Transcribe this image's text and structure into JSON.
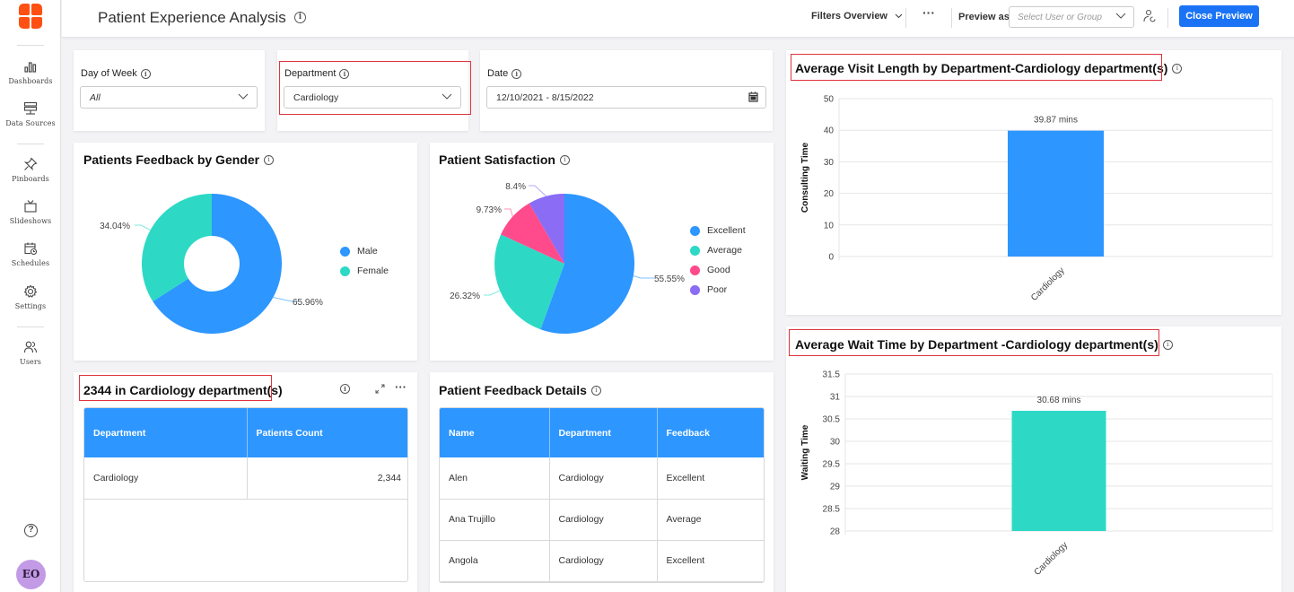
{
  "app": {
    "title": "Patient Experience Analysis",
    "logo": "logo-icon"
  },
  "sidebar": {
    "items": [
      {
        "label": "Dashboards",
        "icon": "bar-chart-icon"
      },
      {
        "label": "Data Sources",
        "icon": "data-sources-icon"
      },
      {
        "label": "Pinboards",
        "icon": "pin-icon"
      },
      {
        "label": "Slideshows",
        "icon": "tv-icon"
      },
      {
        "label": "Schedules",
        "icon": "calendar-clock-icon"
      },
      {
        "label": "Settings",
        "icon": "gear-icon"
      },
      {
        "label": "Users",
        "icon": "users-icon"
      }
    ],
    "help_icon": "help-icon",
    "avatar_initials": "EO"
  },
  "header": {
    "filters_overview": "Filters Overview",
    "more": "···",
    "preview_as_label": "Preview as",
    "user_select_placeholder": "Select User or Group",
    "close_preview": "Close Preview"
  },
  "filters": {
    "day_of_week": {
      "label": "Day of Week",
      "value": "All"
    },
    "department": {
      "label": "Department",
      "value": "Cardiology"
    },
    "date": {
      "label": "Date",
      "value": "12/10/2021 - 8/15/2022"
    }
  },
  "widgets": {
    "gender": {
      "title": "Patients Feedback by Gender"
    },
    "satisfaction": {
      "title": "Patient Satisfaction"
    },
    "count": {
      "title": "2344 in Cardiology department(s)",
      "columns": [
        "Department",
        "Patients Count"
      ],
      "rows": [
        [
          "Cardiology",
          "2,344"
        ]
      ]
    },
    "details": {
      "title": "Patient Feedback Details",
      "columns": [
        "Name",
        "Department",
        "Feedback"
      ],
      "rows": [
        [
          "Alen",
          "Cardiology",
          "Excellent"
        ],
        [
          "Ana Trujillo",
          "Cardiology",
          "Average"
        ],
        [
          "Angola",
          "Cardiology",
          "Excellent"
        ]
      ]
    },
    "visit": {
      "title": "Average Visit Length by Department-Cardiology department(s)"
    },
    "wait": {
      "title": "Average Wait Time by Department -Cardiology department(s)"
    }
  },
  "colors": {
    "blue": "#2d96ff",
    "teal": "#2dd9c5",
    "pink": "#ff4b8b",
    "purple": "#8a6cf5",
    "accent": "#1a73f5",
    "highlight": "#e0333d",
    "excellent": "#3ad06b"
  },
  "chart_data": [
    {
      "type": "pie",
      "title": "Patients Feedback by Gender",
      "donut": true,
      "categories": [
        "Male",
        "Female"
      ],
      "values": [
        65.96,
        34.04
      ],
      "labels": [
        "65.96%",
        "34.04%"
      ],
      "colors": [
        "#2d96ff",
        "#2dd9c5"
      ],
      "legend": "right"
    },
    {
      "type": "pie",
      "title": "Patient Satisfaction",
      "donut": false,
      "categories": [
        "Excellent",
        "Average",
        "Good",
        "Poor"
      ],
      "values": [
        55.55,
        26.32,
        9.73,
        8.4
      ],
      "labels": [
        "55.55%",
        "26.32%",
        "9.73%",
        "8.4%"
      ],
      "colors": [
        "#2d96ff",
        "#2dd9c5",
        "#ff4b8b",
        "#8a6cf5"
      ],
      "legend": "right"
    },
    {
      "type": "bar",
      "title": "Average Visit Length by Department-Cardiology department(s)",
      "categories": [
        "Cardiology"
      ],
      "values": [
        39.87
      ],
      "data_labels": [
        "39.87 mins"
      ],
      "xlabel": "",
      "ylabel": "Consulting Time",
      "ylim": [
        0,
        50
      ],
      "yticks": [
        "0",
        "10",
        "20",
        "30",
        "40",
        "50"
      ],
      "ytick_values": [
        0,
        10,
        20,
        30,
        40,
        50
      ],
      "color": "#2d96ff",
      "grid": true
    },
    {
      "type": "bar",
      "title": "Average Wait Time by Department -Cardiology department(s)",
      "categories": [
        "Cardiology"
      ],
      "values": [
        30.68
      ],
      "data_labels": [
        "30.68 mins"
      ],
      "xlabel": "",
      "ylabel": "Waiting Time",
      "ylim": [
        28,
        31.5
      ],
      "yticks": [
        "28",
        "28.5",
        "29",
        "29.5",
        "30",
        "30.5",
        "31",
        "31.5"
      ],
      "ytick_values": [
        28,
        28.5,
        29,
        29.5,
        30,
        30.5,
        31,
        31.5
      ],
      "color": "#2dd9c5",
      "grid": true
    }
  ]
}
